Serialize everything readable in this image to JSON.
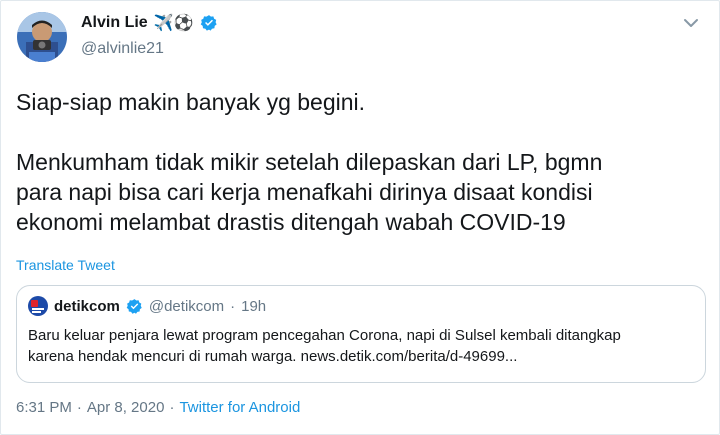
{
  "user": {
    "name": "Alvin Lie",
    "emoji": "✈️⚽",
    "handle": "@alvinlie21"
  },
  "tweet": {
    "line1": "Siap-siap makin banyak yg begini.",
    "para2": "Menkumham tidak mikir setelah dilepaskan dari LP, bgmn\npara napi bisa cari kerja menafkahi dirinya disaat kondisi\nekonomi melambat drastis ditengah wabah COVID-19",
    "translate": "Translate Tweet"
  },
  "quote": {
    "name": "detikcom",
    "handle": "@detikcom",
    "separator": "·",
    "time": "19h",
    "text": "Baru keluar penjara lewat program pencegahan Corona, napi di Sulsel kembali ditangkap\nkarena hendak mencuri di rumah warga. news.detik.com/berita/d-49699..."
  },
  "footer": {
    "time": "6:31 PM",
    "dot": "·",
    "date": "Apr 8, 2020",
    "dot2": "·",
    "source": "Twitter for Android"
  },
  "colors": {
    "link": "#1b95e0",
    "muted": "#657786",
    "border": "#ccd6dd",
    "verified": "#1da1f2"
  }
}
